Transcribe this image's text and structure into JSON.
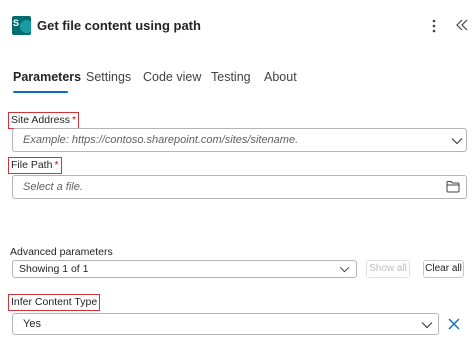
{
  "header": {
    "title": "Get file content using path",
    "app_icon": "sharepoint-icon",
    "app_icon_letter": "S",
    "more_icon": "more-vertical-icon",
    "collapse_icon": "double-chevron-left-icon"
  },
  "tabs": [
    {
      "label": "Parameters",
      "active": true
    },
    {
      "label": "Settings",
      "active": false
    },
    {
      "label": "Code view",
      "active": false
    },
    {
      "label": "Testing",
      "active": false
    },
    {
      "label": "About",
      "active": false
    }
  ],
  "fields": {
    "site_address": {
      "label": "Site Address",
      "required_mark": "*",
      "placeholder": "Example: https://contoso.sharepoint.com/sites/sitename."
    },
    "file_path": {
      "label": "File Path",
      "required_mark": "*",
      "placeholder": "Select a file."
    },
    "advanced": {
      "label": "Advanced parameters",
      "value": "Showing 1 of 1",
      "show_all_label": "Show all",
      "clear_all_label": "Clear all"
    },
    "infer_content_type": {
      "label": "Infer Content Type",
      "value": "Yes"
    }
  },
  "colors": {
    "accent": "#0f6cbd",
    "highlight_outline": "#d13438",
    "brand": "#036C70"
  }
}
